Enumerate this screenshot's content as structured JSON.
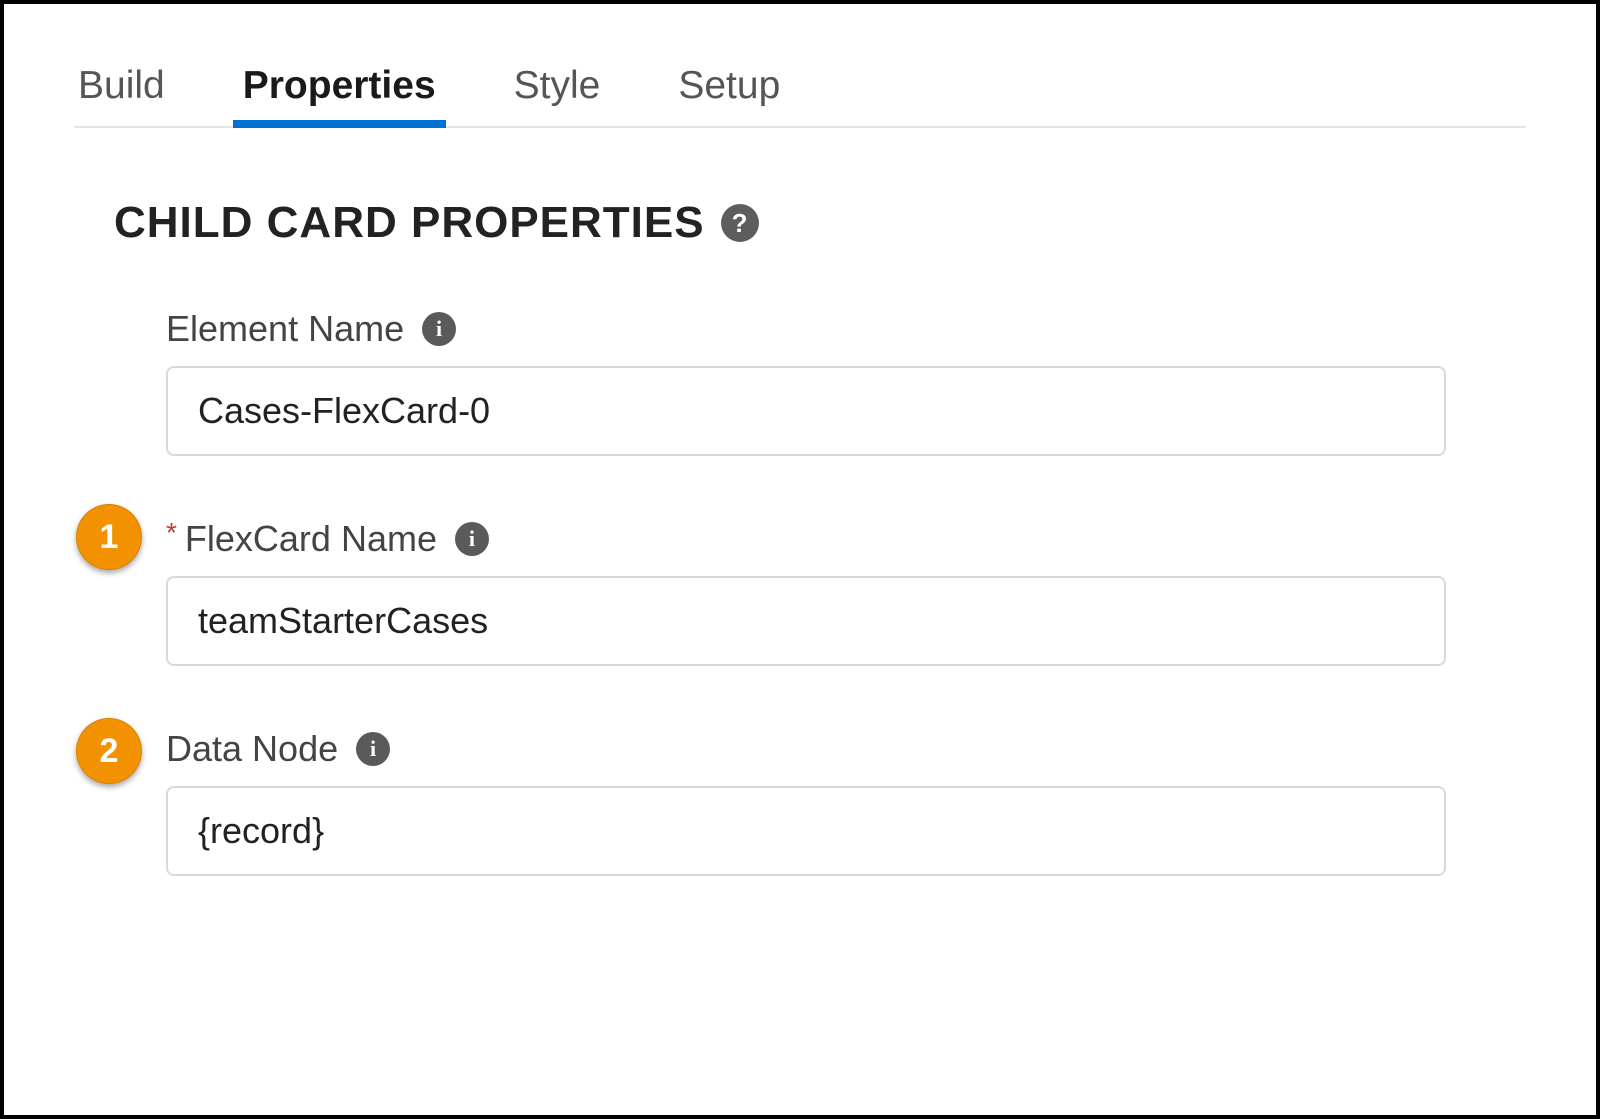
{
  "tabs": {
    "items": [
      {
        "label": "Build",
        "active": false
      },
      {
        "label": "Properties",
        "active": true
      },
      {
        "label": "Style",
        "active": false
      },
      {
        "label": "Setup",
        "active": false
      }
    ]
  },
  "section": {
    "title": "CHILD CARD PROPERTIES"
  },
  "fields": {
    "elementName": {
      "label": "Element Name",
      "value": "Cases-FlexCard-0",
      "required": false
    },
    "flexCardName": {
      "label": "FlexCard Name",
      "value": "teamStarterCases",
      "required": true
    },
    "dataNode": {
      "label": "Data Node",
      "value": "{record}",
      "required": false
    }
  },
  "callouts": {
    "one": "1",
    "two": "2"
  },
  "icons": {
    "help": "?",
    "info": "i"
  }
}
